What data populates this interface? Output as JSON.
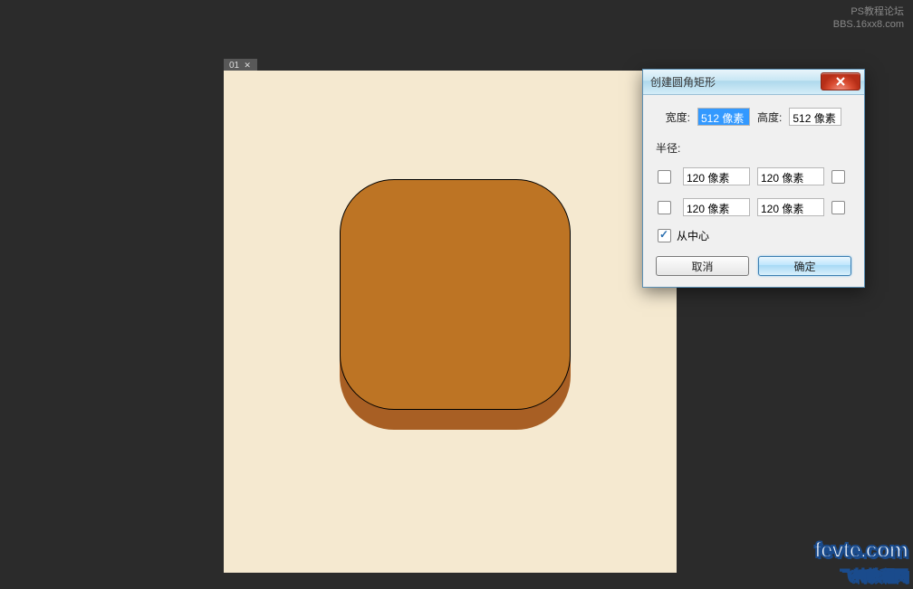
{
  "watermark_top": {
    "line1": "PS教程论坛",
    "line2": "BBS.16xx8.com"
  },
  "canvas": {
    "tab_label": "01"
  },
  "dialog": {
    "title": "创建圆角矩形",
    "width_label": "宽度:",
    "width_value": "512 像素",
    "height_label": "高度:",
    "height_value": "512 像素",
    "radius_label": "半径:",
    "radii": {
      "top_left": "120 像素",
      "top_right": "120 像素",
      "bottom_left": "120 像素",
      "bottom_right": "120 像素"
    },
    "from_center_label": "从中心",
    "from_center_checked": true,
    "cancel_label": "取消",
    "ok_label": "确定"
  },
  "watermark_bottom": {
    "brand": "fevte.com",
    "brand_cn": "飞特教程网"
  }
}
